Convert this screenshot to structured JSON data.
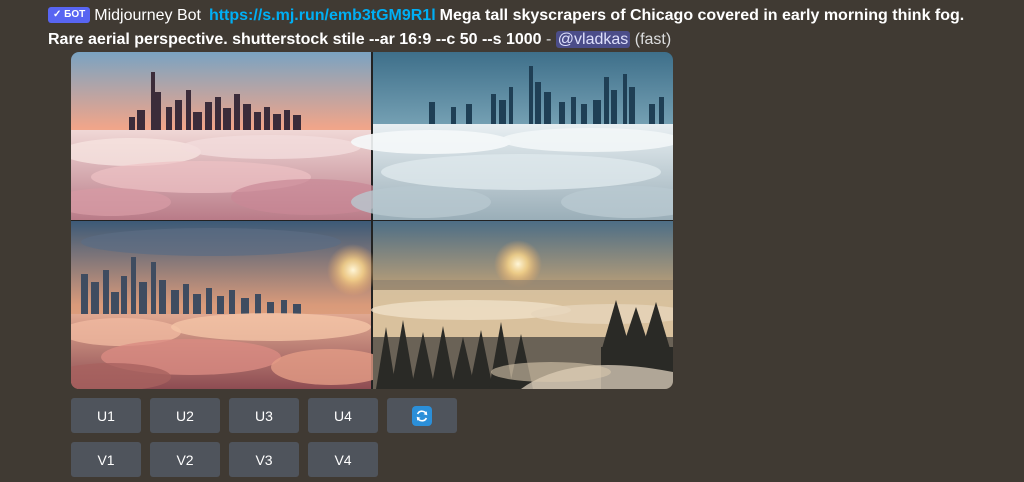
{
  "message": {
    "badge": "✓ БОТ",
    "author": "Midjourney Bot",
    "link": "https://s.mj.run/emb3tGM9R1l",
    "prompt": "Mega tall skyscrapers of Chicago covered in early morning think fog. Rare aerial perspective. shutterstock stile --ar 16:9 --c 50 --s 1000",
    "separator": " - ",
    "mention": "@vladkas",
    "mode": "(fast)"
  },
  "buttons": {
    "upscale": [
      "U1",
      "U2",
      "U3",
      "U4"
    ],
    "variation": [
      "V1",
      "V2",
      "V3",
      "V4"
    ],
    "reroll_icon": "refresh-icon"
  },
  "colors": {
    "background": "#403a33",
    "button": "#4f545c",
    "link": "#00aff4",
    "badge": "#5865f2",
    "reroll": "#2b8fd9"
  }
}
